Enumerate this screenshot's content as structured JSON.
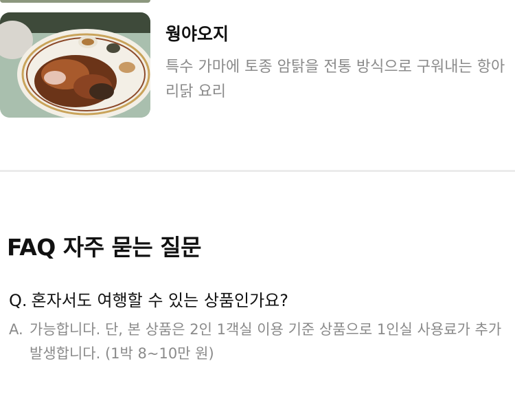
{
  "food": {
    "name": "웡야오지",
    "description": "특수 가마에 토종 암탉을 전통 방식으로 구워내는 항아리닭 요리"
  },
  "faq": {
    "title": "FAQ 자주 묻는 질문",
    "items": [
      {
        "q_prefix": "Q.",
        "question": "혼자서도 여행할 수 있는 상품인가요?",
        "a_prefix": "A.",
        "answer": "가능합니다. 단, 본 상품은 2인 1객실 이용 기준 상품으로 1인실 사용료가 추가 발생합니다. (1박 8~10만 원)"
      }
    ]
  }
}
